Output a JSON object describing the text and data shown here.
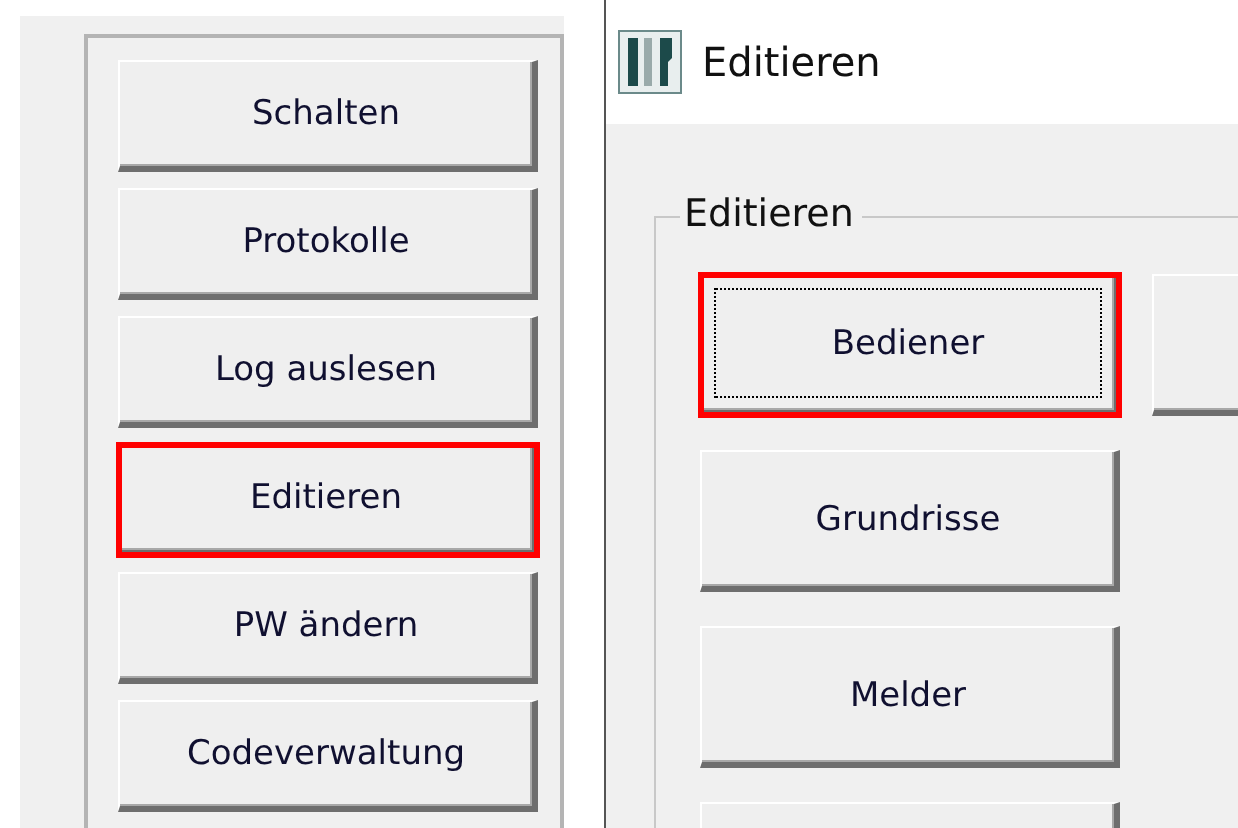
{
  "main_menu": {
    "buttons": [
      {
        "label": "Schalten",
        "highlighted": false
      },
      {
        "label": "Protokolle",
        "highlighted": false
      },
      {
        "label": "Log auslesen",
        "highlighted": false
      },
      {
        "label": "Editieren",
        "highlighted": true
      },
      {
        "label": "PW ändern",
        "highlighted": false
      },
      {
        "label": "Codeverwaltung",
        "highlighted": false
      }
    ]
  },
  "edit_window": {
    "title": "Editieren",
    "group": {
      "legend": "Editieren",
      "buttons": [
        {
          "label": "Bediener",
          "highlighted": true,
          "focused": true
        },
        {
          "label": "Grundrisse",
          "highlighted": false,
          "focused": false
        },
        {
          "label": "Melder",
          "highlighted": false,
          "focused": false
        }
      ]
    }
  }
}
